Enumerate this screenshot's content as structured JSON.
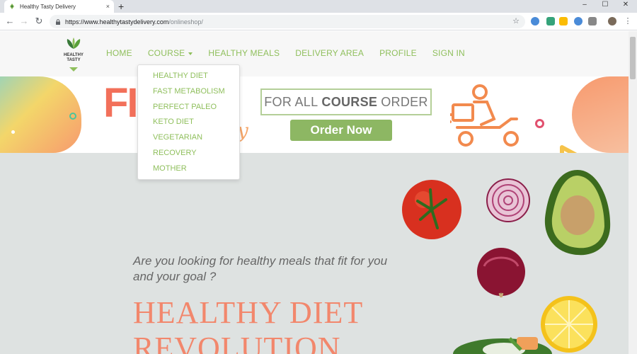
{
  "browser": {
    "tab_title": "Healthy Tasty Delivery",
    "tab_close": "×",
    "new_tab": "+",
    "window_controls": [
      "–",
      "☐",
      "✕"
    ],
    "url_host": "https://www.healthytastydelivery.com",
    "url_path": "/onlineshop/"
  },
  "site": {
    "logo_line1": "HEALTHY",
    "logo_line2": "TASTY",
    "menu": [
      "HOME",
      "COURSE",
      "HEALTHY MEALS",
      "DELIVERY AREA",
      "PROFILE",
      "SIGN IN"
    ],
    "course_dropdown": [
      "HEALTHY DIET",
      "FAST METABOLISM",
      "PERFECT PALEO",
      "KETO DIET",
      "VEGETARIAN",
      "RECOVERY",
      "MOTHER"
    ]
  },
  "banner": {
    "big_text": "FI",
    "offer_prefix": "FOR ALL",
    "offer_bold": "COURSE",
    "offer_suffix": "ORDER",
    "order_button": "Order Now"
  },
  "hero": {
    "question": "Are you looking for healthy meals that fit for you and your goal ?",
    "title": "HEALTHY DIET REVOLUTION"
  },
  "colors": {
    "brand_green": "#8fbf5c",
    "accent_coral": "#f2876c",
    "hero_bg": "#dee2e1"
  }
}
